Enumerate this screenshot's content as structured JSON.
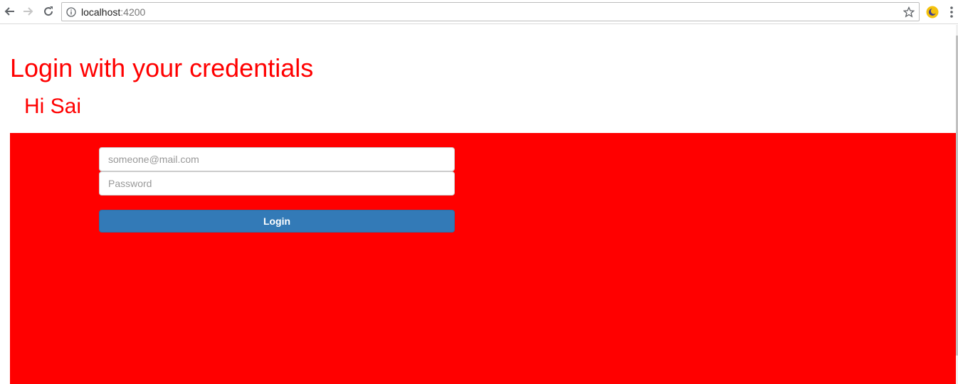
{
  "browser": {
    "url_host": "localhost",
    "url_port": ":4200"
  },
  "page": {
    "title": "Login with your credentials",
    "greeting": "Hi Sai"
  },
  "form": {
    "email_placeholder": "someone@mail.com",
    "password_placeholder": "Password",
    "login_label": "Login"
  },
  "colors": {
    "accent": "#ff0000",
    "button": "#337ab7"
  }
}
